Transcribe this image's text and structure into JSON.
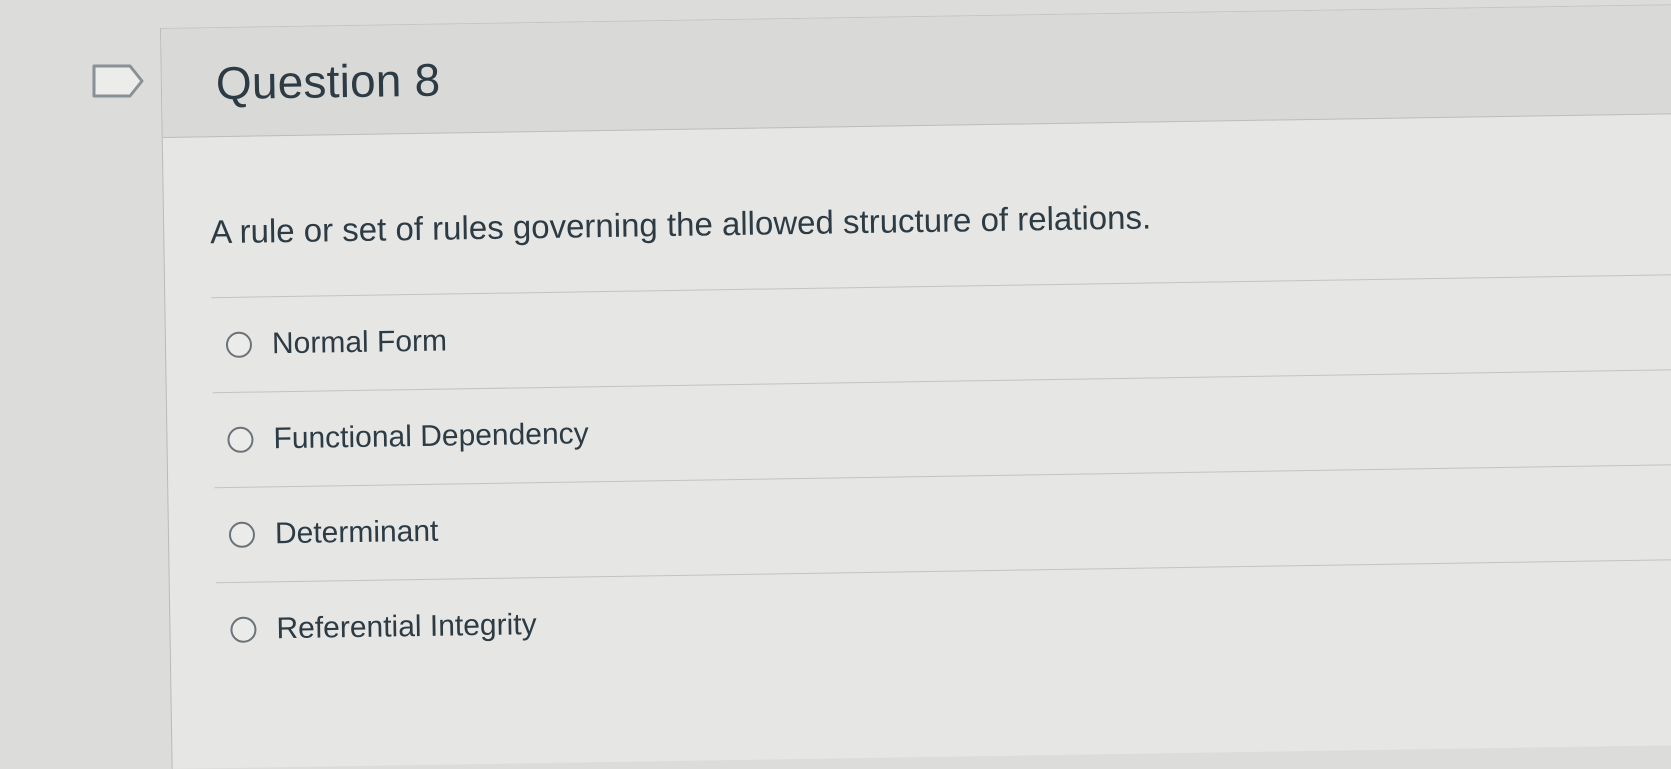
{
  "question": {
    "title": "Question 8",
    "text": "A rule or set of rules governing the allowed structure of relations.",
    "answers": [
      {
        "label": "Normal Form",
        "selected": false
      },
      {
        "label": "Functional Dependency",
        "selected": false
      },
      {
        "label": "Determinant",
        "selected": false
      },
      {
        "label": "Referential Integrity",
        "selected": false
      }
    ]
  },
  "icons": {
    "bookmark": "bookmark-flag-icon"
  },
  "colors": {
    "text": "#2d3b45",
    "background": "#e6e6e4",
    "header": "#d9d9d7"
  }
}
